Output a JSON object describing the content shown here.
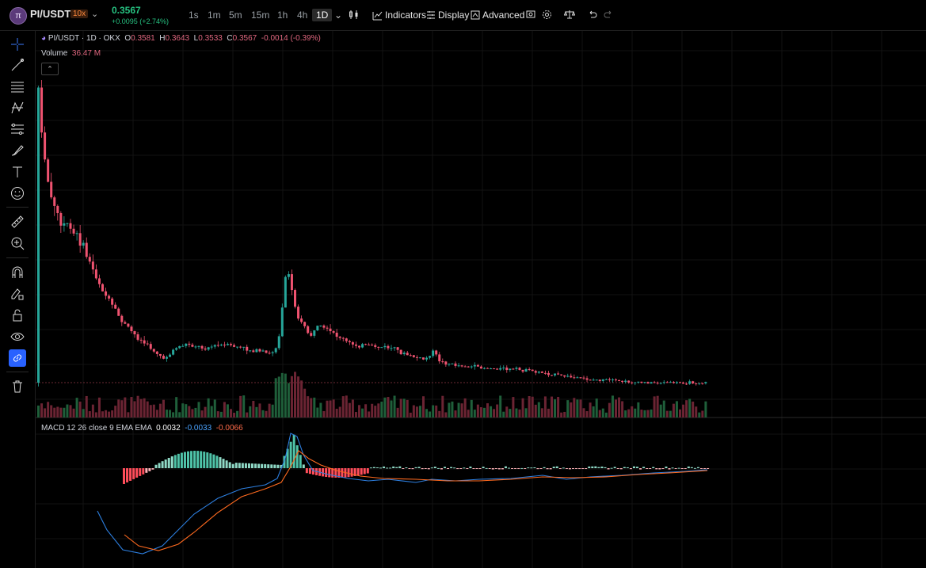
{
  "symbol": {
    "name": "PI/USDT",
    "leverage": "10x",
    "price": "0.3567",
    "change": "+0.0095 (+2.74%)"
  },
  "timeframes": [
    "1s",
    "1m",
    "5m",
    "15m",
    "1h",
    "4h",
    "1D"
  ],
  "active_timeframe": "1D",
  "toolbar": {
    "indicators": "Indicators",
    "display": "Display",
    "advanced": "Advanced"
  },
  "legend": {
    "title": "PI/USDT · 1D · OKX",
    "o_label": "O",
    "o": "0.3581",
    "h_label": "H",
    "h": "0.3643",
    "l_label": "L",
    "l": "0.3533",
    "c_label": "C",
    "c": "0.3567",
    "chg": "-0.0014 (-0.39%)"
  },
  "volume": {
    "label": "Volume",
    "value": "36.47 M"
  },
  "macd": {
    "label": "MACD 12 26 close 9 EMA EMA",
    "v1": "0.0032",
    "v2": "-0.0033",
    "v3": "-0.0066"
  },
  "colors": {
    "up": "#26a69a",
    "down": "#ef5370",
    "macd_line": "#2d7fe0",
    "signal_line": "#ff6a1f",
    "accent": "#2962ff"
  },
  "sidebar_tools": [
    "crosshair-icon",
    "trendline-icon",
    "horizontal-lines-icon",
    "pattern-icon",
    "fib-icon",
    "brush-icon",
    "text-icon",
    "emoji-icon",
    "ruler-icon",
    "zoom-in-icon",
    "magnet-icon",
    "lock-draw-icon",
    "lock-icon",
    "eye-icon",
    "link-icon",
    "trash-icon"
  ]
}
